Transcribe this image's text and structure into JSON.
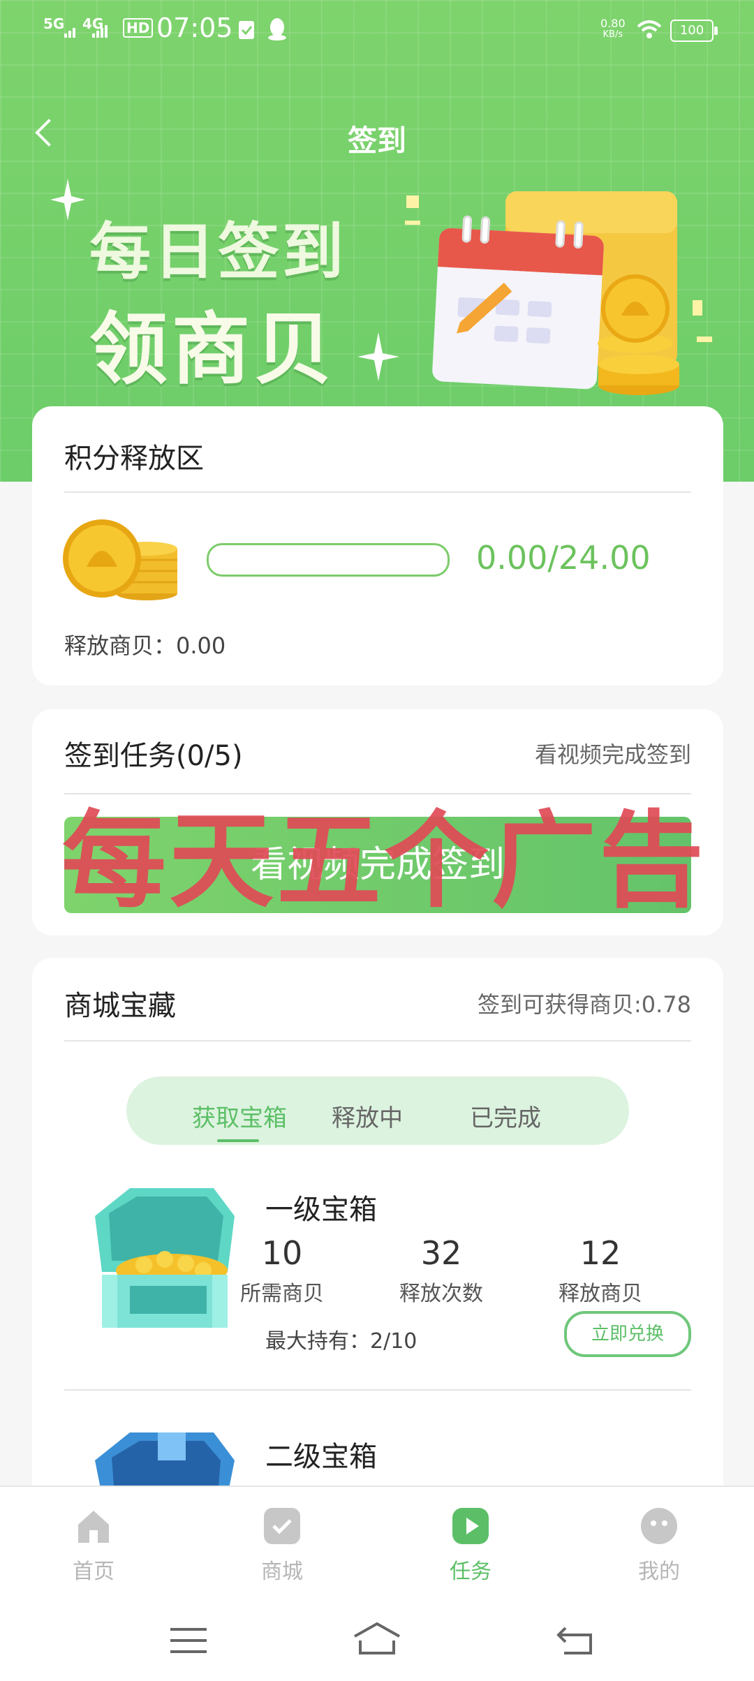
{
  "status_bar": {
    "signal_1": "5G",
    "signal_2": "4G",
    "hd": "HD",
    "time": "07:05",
    "net_speed": "0.80",
    "net_unit": "KB/s",
    "battery": "100"
  },
  "header": {
    "title": "签到",
    "banner_line1": "每日签到",
    "banner_line2": "领商贝"
  },
  "points_release": {
    "title": "积分释放区",
    "progress_text": "0.00/24.00",
    "progress_fraction": 0.0,
    "released_label": "释放商贝：0.00"
  },
  "checkin_task": {
    "title": "签到任务(0/5)",
    "hint": "看视频完成签到",
    "button_label": "看视频完成签到",
    "overlay_text": "每天五个广告"
  },
  "treasure": {
    "title": "商城宝藏",
    "reward_hint": "签到可获得商贝:0.78",
    "tabs": [
      "获取宝箱",
      "释放中",
      "已完成"
    ],
    "active_tab": 0,
    "items": [
      {
        "name": "一级宝箱",
        "stats": [
          {
            "value": "10",
            "label": "所需商贝"
          },
          {
            "value": "32",
            "label": "释放次数"
          },
          {
            "value": "12",
            "label": "释放商贝"
          }
        ],
        "holding": "最大持有：2/10",
        "button": "立即兑换"
      },
      {
        "name": "二级宝箱"
      }
    ]
  },
  "bottom_nav": {
    "items": [
      "首页",
      "商城",
      "任务",
      "我的"
    ],
    "active": 2
  },
  "colors": {
    "brand_green": "#6ccd69",
    "accent_green": "#5cbf67",
    "overlay_red": "#e04a56"
  }
}
